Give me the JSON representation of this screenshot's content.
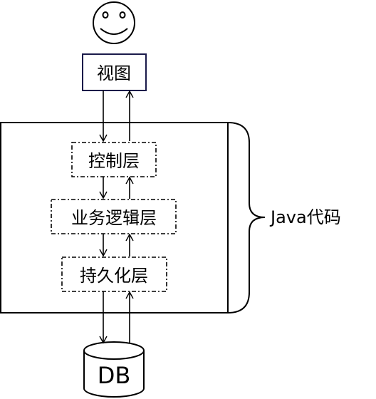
{
  "diagram": {
    "view_label": "视图",
    "controller_label": "控制层",
    "business_label": "业务逻辑层",
    "persistence_label": "持久化层",
    "db_label": "DB",
    "brace_label": "Java代码"
  },
  "icons": {
    "user": "smiley-face-icon",
    "database": "database-cylinder-icon"
  },
  "colors": {
    "view_border": "#1a1a4a",
    "line": "#000000"
  }
}
